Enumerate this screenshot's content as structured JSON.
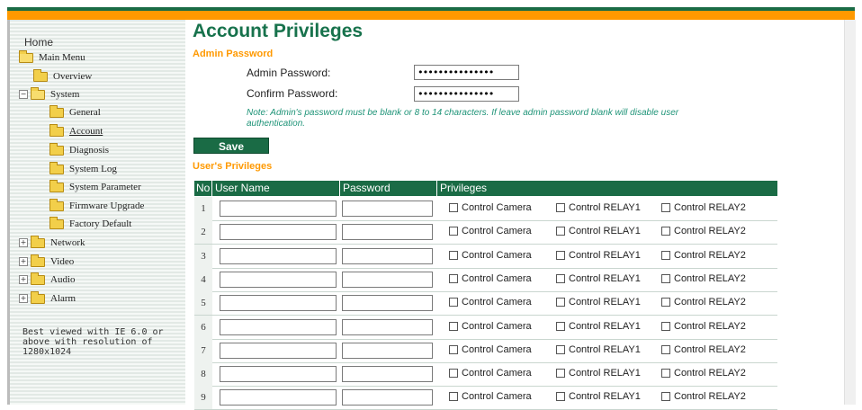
{
  "sidebar": {
    "home": "Home",
    "items": [
      {
        "label": "Main Menu",
        "expander": ""
      },
      {
        "label": "Overview",
        "expander": ""
      },
      {
        "label": "System",
        "expander": "−"
      },
      {
        "label": "General",
        "expander": ""
      },
      {
        "label": "Account",
        "expander": ""
      },
      {
        "label": "Diagnosis",
        "expander": ""
      },
      {
        "label": "System Log",
        "expander": ""
      },
      {
        "label": "System Parameter",
        "expander": ""
      },
      {
        "label": "Firmware Upgrade",
        "expander": ""
      },
      {
        "label": "Factory Default",
        "expander": ""
      },
      {
        "label": "Network",
        "expander": "+"
      },
      {
        "label": "Video",
        "expander": "+"
      },
      {
        "label": "Audio",
        "expander": "+"
      },
      {
        "label": "Alarm",
        "expander": "+"
      }
    ],
    "best_viewed": "Best viewed with IE 6.0 or above with resolution of 1280x1024"
  },
  "main": {
    "title": "Account Privileges",
    "admin_section": "Admin Password",
    "admin_password_label": "Admin Password:",
    "admin_password_value": "•••••••••••••••",
    "confirm_password_label": "Confirm Password:",
    "confirm_password_value": "•••••••••••••••",
    "note": "Note: Admin's password must be blank or 8 to 14 characters. If leave admin password blank will disable user authentication.",
    "save_label": "Save",
    "users_section": "User's Privileges",
    "table": {
      "headers": [
        "No",
        "User Name",
        "Password",
        "Privileges"
      ],
      "rows": [
        "1",
        "2",
        "3",
        "4",
        "5",
        "6",
        "7",
        "8",
        "9"
      ],
      "privileges": [
        "Control Camera",
        "Control RELAY1",
        "Control RELAY2"
      ]
    }
  },
  "colors": {
    "brand_green": "#1a6b45",
    "accent_orange": "#ff9900",
    "note_teal": "#1f9478"
  }
}
